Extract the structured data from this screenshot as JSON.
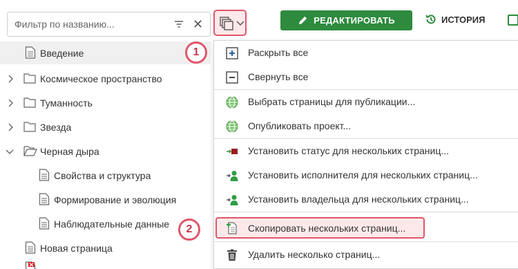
{
  "filter": {
    "placeholder": "Фильтр по названию..."
  },
  "toolbar": {
    "edit_label": "РЕДАКТИРОВАТЬ",
    "history_label": "ИСТОРИЯ"
  },
  "badges": {
    "one": "1",
    "two": "2"
  },
  "tree": [
    {
      "label": "Введение",
      "type": "page",
      "selected": true
    },
    {
      "label": "Космическое пространство",
      "type": "folder",
      "expand": "collapsed"
    },
    {
      "label": "Туманность",
      "type": "folder",
      "expand": "collapsed"
    },
    {
      "label": "Звезда",
      "type": "folder",
      "expand": "collapsed"
    },
    {
      "label": "Черная дыра",
      "type": "folder-open",
      "expand": "expanded"
    },
    {
      "label": "Свойства и структура",
      "type": "page"
    },
    {
      "label": "Формирование и эволюция",
      "type": "page"
    },
    {
      "label": "Наблюдательные данные",
      "type": "page"
    },
    {
      "label": "Новая страница",
      "type": "page"
    }
  ],
  "menu": [
    {
      "label": "Раскрыть все",
      "icon": "expand-all-icon"
    },
    {
      "label": "Свернуть все",
      "icon": "collapse-all-icon"
    },
    {
      "label": "Выбрать страницы для публикации...",
      "icon": "globe-icon"
    },
    {
      "label": "Опубликовать проект...",
      "icon": "globe-icon"
    },
    {
      "label": "Установить статус для нескольких страниц...",
      "icon": "status-flag-icon"
    },
    {
      "label": "Установить исполнителя для нескольких страниц...",
      "icon": "assignee-icon"
    },
    {
      "label": "Установить владельца для нескольких страниц...",
      "icon": "owner-icon"
    },
    {
      "label": "Скопировать нескольких страниц...",
      "icon": "copy-pages-icon"
    },
    {
      "label": "Удалить несколько страниц...",
      "icon": "trash-icon"
    }
  ],
  "colors": {
    "accent_green": "#2e8b3e",
    "highlight_red": "#e0566a",
    "highlight_fill": "#fde9ea"
  }
}
